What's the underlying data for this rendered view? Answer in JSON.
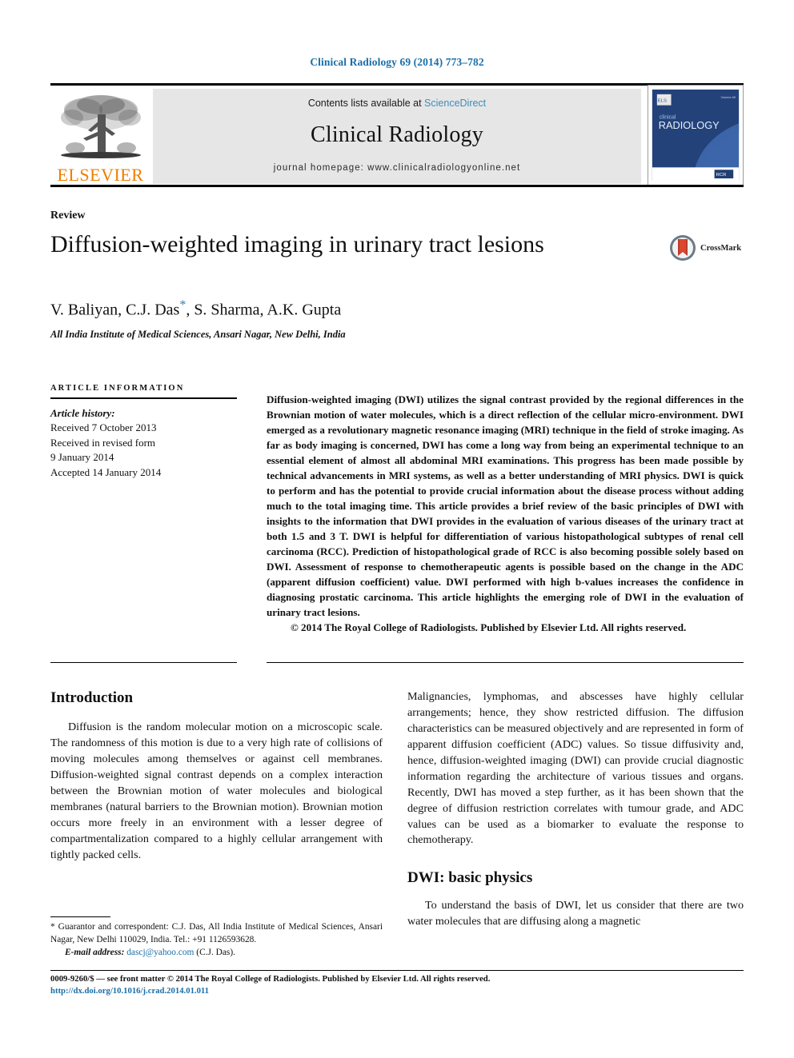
{
  "journal_ref": "Clinical Radiology 69 (2014) 773–782",
  "masthead": {
    "contents_prefix": "Contents lists available at ",
    "sciencedirect": "ScienceDirect",
    "journal_title": "Clinical Radiology",
    "homepage": "journal homepage: www.clinicalradiologyonline.net",
    "elsevier_wordmark": "ELSEVIER",
    "cover_title_line1": "clinical",
    "cover_title_line2": "RADIOLOGY"
  },
  "article": {
    "type": "Review",
    "title": "Diffusion-weighted imaging in urinary tract lesions",
    "authors": "V. Baliyan, C.J. Das",
    "authors_star": "*",
    "authors_rest": ", S. Sharma, A.K. Gupta",
    "affiliation": "All India Institute of Medical Sciences, Ansari Nagar, New Delhi, India",
    "crossmark_label": "CrossMark"
  },
  "article_information": {
    "heading": "Article information",
    "history_label": "Article history:",
    "received": "Received 7 October 2013",
    "revised_label": "Received in revised form",
    "revised_date": "9 January 2014",
    "accepted": "Accepted 14 January 2014"
  },
  "abstract": {
    "text": "Diffusion-weighted imaging (DWI) utilizes the signal contrast provided by the regional differences in the Brownian motion of water molecules, which is a direct reflection of the cellular micro-environment. DWI emerged as a revolutionary magnetic resonance imaging (MRI) technique in the field of stroke imaging. As far as body imaging is concerned, DWI has come a long way from being an experimental technique to an essential element of almost all abdominal MRI examinations. This progress has been made possible by technical advancements in MRI systems, as well as a better understanding of MRI physics. DWI is quick to perform and has the potential to provide crucial information about the disease process without adding much to the total imaging time. This article provides a brief review of the basic principles of DWI with insights to the information that DWI provides in the evaluation of various diseases of the urinary tract at both 1.5 and 3 T. DWI is helpful for differentiation of various histopathological subtypes of renal cell carcinoma (RCC). Prediction of histopathological grade of RCC is also becoming possible solely based on DWI. Assessment of response to chemotherapeutic agents is possible based on the change in the ADC (apparent diffusion coefficient) value. DWI performed with high b-values increases the confidence in diagnosing prostatic carcinoma. This article highlights the emerging role of DWI in the evaluation of urinary tract lesions.",
    "copyright": "© 2014 The Royal College of Radiologists. Published by Elsevier Ltd. All rights reserved."
  },
  "body": {
    "intro_heading": "Introduction",
    "intro_paragraph": "Diffusion is the random molecular motion on a microscopic scale. The randomness of this motion is due to a very high rate of collisions of moving molecules among themselves or against cell membranes. Diffusion-weighted signal contrast depends on a complex interaction between the Brownian motion of water molecules and biological membranes (natural barriers to the Brownian motion). Brownian motion occurs more freely in an environment with a lesser degree of compartmentalization compared to a highly cellular arrangement with tightly packed cells.",
    "right_continuation": "Malignancies, lymphomas, and abscesses have highly cellular arrangements; hence, they show restricted diffusion. The diffusion characteristics can be measured objectively and are represented in form of apparent diffusion coefficient (ADC) values. So tissue diffusivity and, hence, diffusion-weighted imaging (DWI) can provide crucial diagnostic information regarding the architecture of various tissues and organs. Recently, DWI has moved a step further, as it has been shown that the degree of diffusion restriction correlates with tumour grade, and ADC values can be used as a biomarker to evaluate the response to chemotherapy.",
    "physics_heading": "DWI: basic physics",
    "physics_paragraph": "To understand the basis of DWI, let us consider that there are two water molecules that are diffusing along a magnetic"
  },
  "footnote": {
    "correspondence": "* Guarantor and correspondent: C.J. Das, All India Institute of Medical Sciences, Ansari Nagar, New Delhi 110029, India. Tel.: +91 1126593628.",
    "email_label": "E-mail address:",
    "email": "dascj@yahoo.com",
    "email_suffix": "(C.J. Das)."
  },
  "bottom": {
    "issn_line": "0009-9260/$ — see front matter © 2014 The Royal College of Radiologists. Published by Elsevier Ltd. All rights reserved.",
    "doi": "http://dx.doi.org/10.1016/j.crad.2014.01.011"
  },
  "colors": {
    "link_blue": "#1a6ea8",
    "sciencedirect_blue": "#3c8dbc",
    "elsevier_orange": "#ef7d00",
    "band_grey": "#e6e6e6",
    "cover_navy": "#1f3f72"
  }
}
